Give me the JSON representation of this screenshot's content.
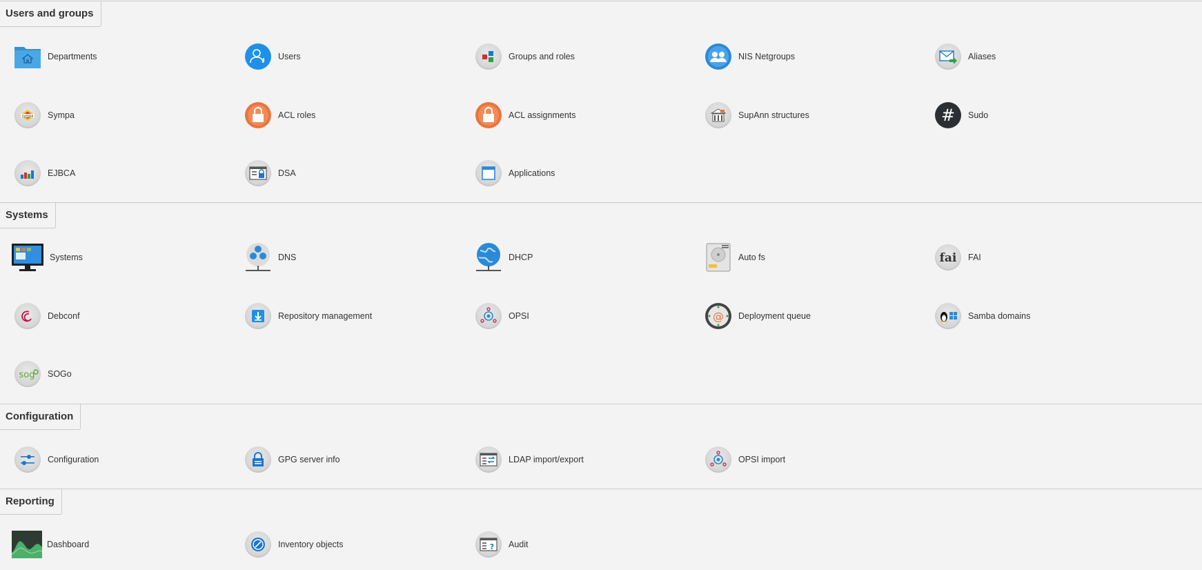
{
  "sections": [
    {
      "title": "Users and groups",
      "items": [
        {
          "label": "Departments",
          "icon": "departments-icon"
        },
        {
          "label": "Users",
          "icon": "users-icon"
        },
        {
          "label": "Groups and roles",
          "icon": "groups-roles-icon"
        },
        {
          "label": "NIS Netgroups",
          "icon": "nis-netgroups-icon"
        },
        {
          "label": "Aliases",
          "icon": "aliases-icon"
        },
        {
          "label": "Sympa",
          "icon": "sympa-icon"
        },
        {
          "label": "ACL roles",
          "icon": "acl-roles-icon"
        },
        {
          "label": "ACL assignments",
          "icon": "acl-assignments-icon"
        },
        {
          "label": "SupAnn structures",
          "icon": "supann-structures-icon"
        },
        {
          "label": "Sudo",
          "icon": "sudo-icon"
        },
        {
          "label": "EJBCA",
          "icon": "ejbca-icon"
        },
        {
          "label": "DSA",
          "icon": "dsa-icon"
        },
        {
          "label": "Applications",
          "icon": "applications-icon"
        }
      ]
    },
    {
      "title": "Systems",
      "items": [
        {
          "label": "Systems",
          "icon": "systems-icon"
        },
        {
          "label": "DNS",
          "icon": "dns-icon"
        },
        {
          "label": "DHCP",
          "icon": "dhcp-icon"
        },
        {
          "label": "Auto fs",
          "icon": "autofs-icon"
        },
        {
          "label": "FAI",
          "icon": "fai-icon"
        },
        {
          "label": "Debconf",
          "icon": "debconf-icon"
        },
        {
          "label": "Repository management",
          "icon": "repository-management-icon"
        },
        {
          "label": "OPSI",
          "icon": "opsi-icon"
        },
        {
          "label": "Deployment queue",
          "icon": "deployment-queue-icon"
        },
        {
          "label": "Samba domains",
          "icon": "samba-domains-icon"
        },
        {
          "label": "SOGo",
          "icon": "sogo-icon"
        }
      ]
    },
    {
      "title": "Configuration",
      "items": [
        {
          "label": "Configuration",
          "icon": "configuration-icon"
        },
        {
          "label": "GPG server info",
          "icon": "gpg-server-info-icon"
        },
        {
          "label": "LDAP import/export",
          "icon": "ldap-import-export-icon"
        },
        {
          "label": "OPSI import",
          "icon": "opsi-import-icon"
        }
      ]
    },
    {
      "title": "Reporting",
      "items": [
        {
          "label": "Dashboard",
          "icon": "dashboard-icon"
        },
        {
          "label": "Inventory objects",
          "icon": "inventory-objects-icon"
        },
        {
          "label": "Audit",
          "icon": "audit-icon"
        }
      ]
    }
  ]
}
